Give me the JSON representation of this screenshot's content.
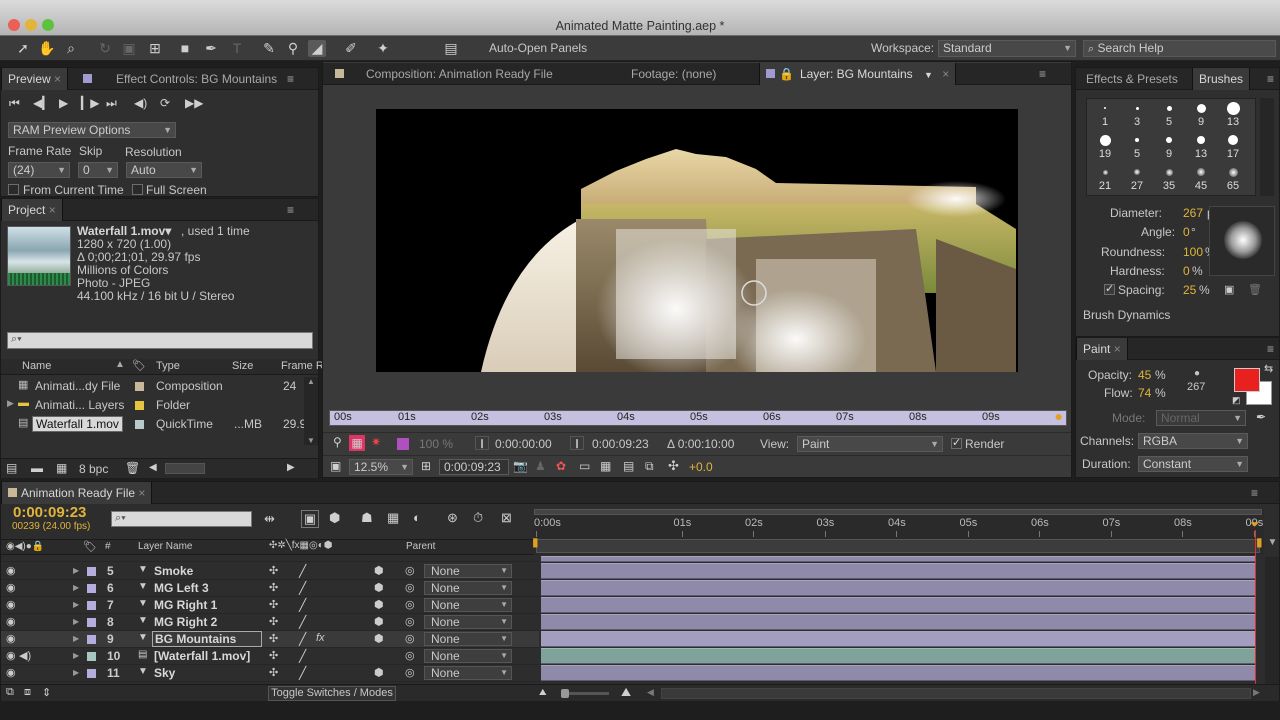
{
  "window": {
    "title": "Animated Matte Painting.aep *"
  },
  "toolbar": {
    "auto_open_label": "Auto-Open Panels",
    "workspace_label": "Workspace:",
    "workspace_value": "Standard",
    "search_placeholder": "Search Help"
  },
  "preview": {
    "tab_preview": "Preview",
    "tab_effect_controls": "Effect Controls: BG Mountains",
    "ram_options": "RAM Preview Options",
    "frame_rate_label": "Frame Rate",
    "skip_label": "Skip",
    "resolution_label": "Resolution",
    "frame_rate_value": "(24)",
    "skip_value": "0",
    "resolution_value": "Auto",
    "from_current_time": "From Current Time",
    "full_screen": "Full Screen"
  },
  "project": {
    "tab": "Project",
    "file_name": "Waterfall 1.mov▾",
    "used": ", used 1 time",
    "info": [
      "1280 x 720 (1.00)",
      "Δ 0;00;21;01, 29.97 fps",
      "Millions of Colors",
      "Photo - JPEG",
      "44.100 kHz / 16 bit U / Stereo"
    ],
    "search_placeholder": "",
    "columns": {
      "name": "Name",
      "type": "Type",
      "size": "Size",
      "frame": "Frame R."
    },
    "items": [
      {
        "name": "Animati...dy File",
        "type": "Composition",
        "size": "",
        "frame": "24",
        "color": "#c8b89a"
      },
      {
        "name": "Animati... Layers",
        "type": "Folder",
        "size": "",
        "frame": "",
        "color": "#e5c540"
      },
      {
        "name": "Waterfall 1.mov",
        "type": "QuickTime",
        "size": "...MB",
        "frame": "29.9",
        "color": "#b9c9c9"
      }
    ],
    "bpc": "8 bpc"
  },
  "viewer": {
    "tab_comp": "Composition: Animation Ready File",
    "tab_footage": "Footage: (none)",
    "tab_layer": "Layer: BG Mountains",
    "ruler": [
      "00s",
      "01s",
      "02s",
      "03s",
      "04s",
      "05s",
      "06s",
      "07s",
      "08s",
      "09s"
    ],
    "zoom_pct": "100 %",
    "time_in": "0:00:00:00",
    "time_out": "0:00:09:23",
    "duration": "Δ 0:00:10:00",
    "view_label": "View:",
    "view_value": "Paint",
    "render_label": "Render",
    "magnification": "12.5%",
    "current_time": "0:00:09:23",
    "exposure": "+0.0"
  },
  "effects": {
    "tab_effects": "Effects & Presets",
    "tab_brushes": "Brushes",
    "brush_sizes": [
      "1",
      "3",
      "5",
      "9",
      "13",
      "19",
      "5",
      "9",
      "13",
      "17",
      "21",
      "27",
      "35",
      "45",
      "65"
    ],
    "diameter_label": "Diameter:",
    "diameter_value": "267",
    "diameter_unit": "px",
    "angle_label": "Angle:",
    "angle_value": "0",
    "angle_unit": "°",
    "roundness_label": "Roundness:",
    "roundness_value": "100",
    "hardness_label": "Hardness:",
    "hardness_value": "0",
    "spacing_label": "Spacing:",
    "spacing_value": "25",
    "percent": "%",
    "brush_dynamics": "Brush Dynamics"
  },
  "paint": {
    "tab": "Paint",
    "opacity_label": "Opacity:",
    "opacity_value": "45",
    "flow_label": "Flow:",
    "flow_value": "74",
    "percent": "%",
    "brush_size": "267",
    "mode_label": "Mode:",
    "mode_value": "Normal",
    "channels_label": "Channels:",
    "channels_value": "RGBA",
    "duration_label": "Duration:",
    "duration_value": "Constant",
    "fg_color": "#e8201e",
    "bg_color": "#ffffff"
  },
  "timeline": {
    "tab": "Animation Ready File",
    "current_time": "0:00:09:23",
    "frame_info": "00239 (24.00 fps)",
    "search_placeholder": "",
    "col_layer_name": "Layer Name",
    "col_parent": "Parent",
    "col_num": "#",
    "ruler": [
      "0:00s",
      "01s",
      "02s",
      "03s",
      "04s",
      "05s",
      "06s",
      "07s",
      "08s",
      "09s"
    ],
    "layers": [
      {
        "num": "5",
        "name": "Smoke",
        "parent": "None",
        "color": "#b3aedd"
      },
      {
        "num": "6",
        "name": "MG Left 3",
        "parent": "None",
        "color": "#b3aedd"
      },
      {
        "num": "7",
        "name": "MG Right 1",
        "parent": "None",
        "color": "#b3aedd"
      },
      {
        "num": "8",
        "name": "MG Right 2",
        "parent": "None",
        "color": "#b3aedd"
      },
      {
        "num": "9",
        "name": "BG Mountains",
        "parent": "None",
        "color": "#b3aedd"
      },
      {
        "num": "10",
        "name": "[Waterfall 1.mov]",
        "parent": "None",
        "color": "#a6c8c0"
      },
      {
        "num": "11",
        "name": "Sky",
        "parent": "None",
        "color": "#b3aedd"
      }
    ],
    "toggle_label": "Toggle Switches / Modes"
  },
  "colors": {
    "accent": "#e0b43a",
    "track": "#8f8aa9",
    "track_teal": "#7fa39a",
    "work_area": "#e0a020"
  }
}
